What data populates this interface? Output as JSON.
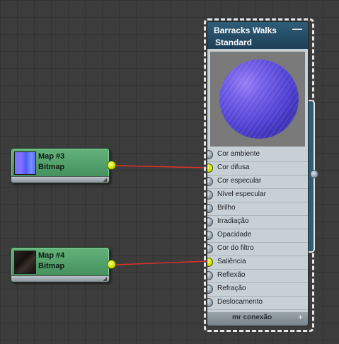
{
  "material": {
    "title": "Barracks Walks",
    "type": "Standard",
    "collapse_glyph": "—",
    "footer_label": "mr conexão",
    "footer_plus": "+",
    "slots": [
      {
        "label": "Cor ambiente",
        "connected": false
      },
      {
        "label": "Cor difusa",
        "connected": true
      },
      {
        "label": "Cor especular",
        "connected": false
      },
      {
        "label": "Nível especular",
        "connected": false
      },
      {
        "label": "Brilho",
        "connected": false
      },
      {
        "label": "Irradiação",
        "connected": false
      },
      {
        "label": "Opacidade",
        "connected": false
      },
      {
        "label": "Cor do filtro",
        "connected": false
      },
      {
        "label": "Saliência",
        "connected": true
      },
      {
        "label": "Reflexão",
        "connected": false
      },
      {
        "label": "Refração",
        "connected": false
      },
      {
        "label": "Deslocamento",
        "connected": false
      }
    ]
  },
  "maps": [
    {
      "name": "Map #3",
      "type": "Bitmap",
      "thumb": "normal-map-thumbnail",
      "connects_to": "Cor difusa"
    },
    {
      "name": "Map #4",
      "type": "Bitmap",
      "thumb": "dark-texture-thumbnail",
      "connects_to": "Saliência"
    }
  ],
  "colors": {
    "canvas": "#3c3c3c",
    "map_node": "#5aa872",
    "material_header": "#2f5d78",
    "wire": "#e0302a",
    "active_socket": "#d4f000"
  },
  "footer_grip_glyph": "◢"
}
